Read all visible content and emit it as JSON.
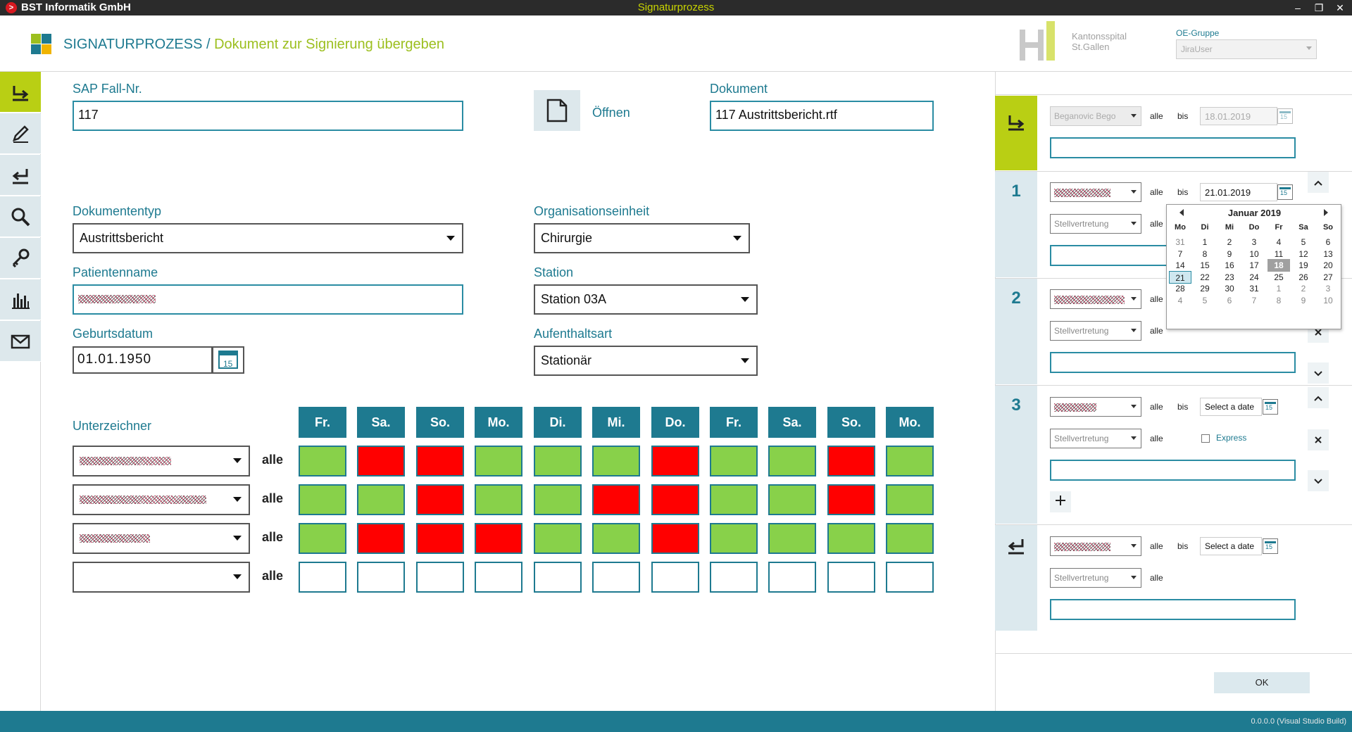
{
  "window": {
    "company": "BST Informatik GmbH",
    "title": "Signaturprozess",
    "controls": [
      "–",
      "❐",
      "✕"
    ]
  },
  "header": {
    "crumb_main": "SIGNATURPROZESS",
    "crumb_sep": " / ",
    "crumb_sub": "Dokument zur Signierung übergeben",
    "logo_text_1": "Kantonsspital",
    "logo_text_2": "St.Gallen",
    "oe_label": "OE-Gruppe",
    "oe_value": "JiraUser"
  },
  "form": {
    "sap_label": "SAP Fall-Nr.",
    "sap_value": "117",
    "open_label": "Öffnen",
    "doc_label": "Dokument",
    "doc_value": "117 Austrittsbericht.rtf",
    "doctype_label": "Dokumententyp",
    "doctype_value": "Austrittsbericht",
    "org_label": "Organisationseinheit",
    "org_value": "Chirurgie",
    "patient_label": "Patientenname",
    "station_label": "Station",
    "station_value": "Station 03A",
    "birth_label": "Geburtsdatum",
    "birth_value": "01.01.1950",
    "stay_label": "Aufenthaltsart",
    "stay_value": "Stationär",
    "signers_label": "Unterzeichner",
    "alle": "alle",
    "calendar_day_icon": "15"
  },
  "schedule": {
    "days": [
      "Fr.",
      "Sa.",
      "So.",
      "Mo.",
      "Di.",
      "Mi.",
      "Do.",
      "Fr.",
      "Sa.",
      "So.",
      "Mo."
    ],
    "rows": [
      [
        "g",
        "r",
        "r",
        "g",
        "g",
        "g",
        "r",
        "g",
        "g",
        "r",
        "g"
      ],
      [
        "g",
        "g",
        "r",
        "g",
        "g",
        "r",
        "r",
        "g",
        "g",
        "r",
        "g"
      ],
      [
        "g",
        "r",
        "r",
        "r",
        "g",
        "g",
        "r",
        "g",
        "g",
        "g",
        "g"
      ],
      [
        "w",
        "w",
        "w",
        "w",
        "w",
        "w",
        "w",
        "w",
        "w",
        "w",
        "w"
      ]
    ],
    "colors": {
      "g": "#88d14a",
      "r": "#ff0000",
      "w": "#ffffff",
      "header": "#1e7a90"
    }
  },
  "right": {
    "step0_user": "Beganovic Bego",
    "step0_date": "18.01.2019",
    "step1_num": "1",
    "step1_date": "21.01.2019",
    "step2_num": "2",
    "step3_num": "3",
    "stellvertretung": "Stellvertretung",
    "alle": "alle",
    "bis": "bis",
    "select_date": "Select a date",
    "express": "Express",
    "ok": "OK"
  },
  "calendar": {
    "month": "Januar 2019",
    "weekdays": [
      "Mo",
      "Di",
      "Mi",
      "Do",
      "Fr",
      "Sa",
      "So"
    ],
    "weeks": [
      [
        "31",
        "1",
        "2",
        "3",
        "4",
        "5",
        "6"
      ],
      [
        "7",
        "8",
        "9",
        "10",
        "11",
        "12",
        "13"
      ],
      [
        "14",
        "15",
        "16",
        "17",
        "18",
        "19",
        "20"
      ],
      [
        "21",
        "22",
        "23",
        "24",
        "25",
        "26",
        "27"
      ],
      [
        "28",
        "29",
        "30",
        "31",
        "1",
        "2",
        "3"
      ],
      [
        "4",
        "5",
        "6",
        "7",
        "8",
        "9",
        "10"
      ]
    ],
    "selected": "18",
    "today": "21"
  },
  "footer": {
    "version": "0.0.0.0 (Visual Studio Build)"
  },
  "colors": {
    "teal": "#1e7a90",
    "lime": "#b9cf14",
    "nav_bg": "#dde8ec"
  }
}
